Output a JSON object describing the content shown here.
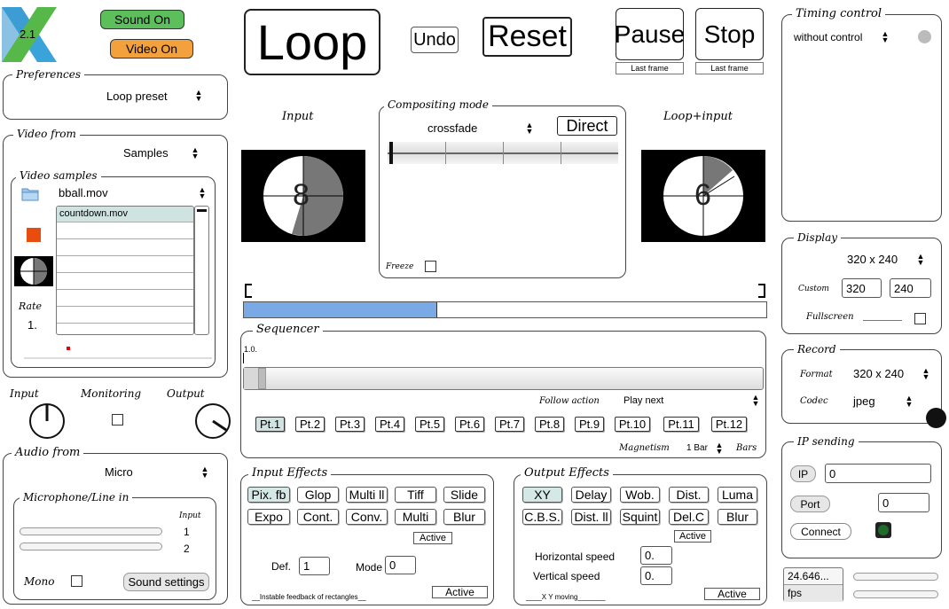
{
  "app": {
    "logo_version": "2.1",
    "sound_label": "Sound On",
    "video_label": "Video On"
  },
  "colors": {
    "sound": "#5cbf5c",
    "video": "#f2a13c",
    "accent_blue": "#7aaae6",
    "stop_red": "#e84d0e",
    "selected": "#d4e8e6"
  },
  "preferences": {
    "title": "Preferences",
    "value": "Loop preset"
  },
  "video_from": {
    "title": "Video from",
    "value": "Samples",
    "samples_title": "Video samples",
    "file": "bball.mov",
    "list": [
      "countdown.mov",
      "",
      "",
      "",
      "",
      "",
      "",
      ""
    ],
    "rate_label": "Rate",
    "rate_value": "1."
  },
  "monitoring": {
    "input_label": "Input",
    "monitoring_label": "Monitoring",
    "output_label": "Output"
  },
  "audio_from": {
    "title": "Audio from",
    "value": "Micro",
    "mic_title": "Microphone/Line in",
    "input_header": "Input",
    "channels": [
      "1",
      "2"
    ],
    "mono_label": "Mono",
    "settings_label": "Sound settings"
  },
  "transport": {
    "loop": "Loop",
    "undo": "Undo",
    "reset": "Reset",
    "pause": "Pause",
    "stop": "Stop",
    "pause_sub": "Last frame",
    "stop_sub": "Last frame"
  },
  "input_title": "Input",
  "loop_input_title": "Loop+input",
  "input_frame_digit": "8",
  "loop_frame_digit": "6",
  "compositing": {
    "title": "Compositing mode",
    "mode": "crossfade",
    "direct": "Direct",
    "freeze": "Freeze"
  },
  "loop_progress": 0.37,
  "sequencer": {
    "title": "Sequencer",
    "value": "1.0.",
    "follow_label": "Follow action",
    "follow_value": "Play next",
    "points": [
      "Pt.1",
      "Pt.2",
      "Pt.3",
      "Pt.4",
      "Pt.5",
      "Pt.6",
      "Pt.7",
      "Pt.8",
      "Pt.9",
      "Pt.10",
      "Pt.11",
      "Pt.12"
    ],
    "magnetism_label": "Magnetism",
    "magnetism_value": "1 Bar",
    "bars_label": "Bars"
  },
  "input_effects": {
    "title": "Input Effects",
    "buttons": [
      "Pix. fb",
      "Glop",
      "Multi ll",
      "Tiff",
      "Slide",
      "Expo",
      "Cont.",
      "Conv.",
      "Multi",
      "Blur"
    ],
    "active": "Active",
    "def_label": "Def.",
    "def_value": "1",
    "mode_label": "Mode",
    "mode_value": "0",
    "note": "__Instable feedback  of rectangles__",
    "active2": "Active"
  },
  "output_effects": {
    "title": "Output Effects",
    "buttons": [
      "XY",
      "Delay",
      "Wob.",
      "Dist.",
      "Luma",
      "C.B.S.",
      "Dist. ll",
      "Squint",
      "Del.C",
      "Blur"
    ],
    "active": "Active",
    "hspeed_label": "Horizontal speed",
    "hspeed_value": "0.",
    "vspeed_label": "Vertical speed",
    "vspeed_value": "0.",
    "note": "____X Y moving_______",
    "active2": "Active"
  },
  "timing": {
    "title": "Timing control",
    "value": "without control"
  },
  "display": {
    "title": "Display",
    "size": "320 x 240",
    "custom_label": "Custom",
    "width": "320",
    "height": "240",
    "fullscreen_label": "Fullscreen"
  },
  "record": {
    "title": "Record",
    "format_label": "Format",
    "format_value": "320 x 240",
    "codec_label": "Codec",
    "codec_value": "jpeg"
  },
  "ip": {
    "title": "IP sending",
    "ip_label": "IP",
    "ip_value": "0",
    "port_label": "Port",
    "port_value": "0",
    "connect": "Connect"
  },
  "fps": {
    "value": "24.646...",
    "label": "fps"
  }
}
